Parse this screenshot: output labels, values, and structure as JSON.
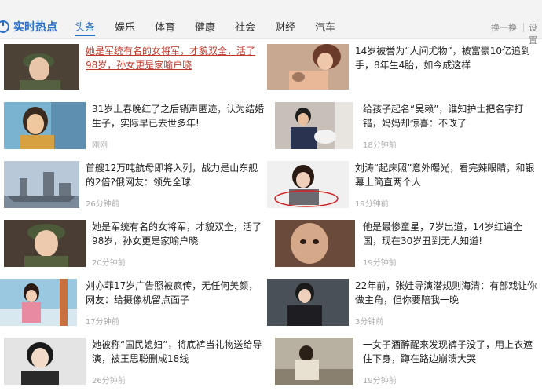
{
  "header": {
    "brand_title": "实时热点",
    "tabs": [
      "头条",
      "娱乐",
      "体育",
      "健康",
      "社会",
      "财经",
      "汽车"
    ],
    "refresh_label": "换一换",
    "settings_label": "设置"
  },
  "left_column": [
    {
      "title": "她是军统有名的女将军，才貌双全，活了98岁，孙女更是家喻户晓",
      "time": "",
      "visited": true
    },
    {
      "title": "31岁上春晚红了之后销声匿迹，认为结婚生子，实际早已去世多年!",
      "time": "刚刚"
    },
    {
      "title": "首艘12万吨航母即将入列，战力是山东舰的2倍?俄网友：领先全球",
      "time": "26分钟前"
    },
    {
      "title": "她是军统有名的女将军，才貌双全，活了98岁，孙女更是家喻户晓",
      "time": "20分钟前"
    },
    {
      "title": "刘亦菲17岁广告照被疯传，无任何美颜，网友：给摄像机留点面子",
      "time": "17分钟前"
    },
    {
      "title": "她被称“国民媳妇”，将底裤当礼物送给导演，被王思聪删成18线",
      "time": "26分钟前"
    }
  ],
  "right_column": [
    {
      "title": "14岁被誉为“人间尤物”，被富豪10亿追到手，8年生4胎，如今成这样",
      "time": ""
    },
    {
      "title": "给孩子起名“吴赖”，谁知护士把名字打错，妈妈却惊喜：不改了",
      "time": "18分钟前"
    },
    {
      "title": "刘涛“起床照”意外曝光，看完辣眼睛，和银幕上简直两个人",
      "time": "19分钟前"
    },
    {
      "title": "他是最惨童星，7岁出道，14岁红遍全国，现在30岁丑到无人知道!",
      "time": "19分钟前"
    },
    {
      "title": "22年前，张娃导演潜规则海清：有部戏让你做主角，但你要陪我一晚",
      "time": "3分钟前"
    },
    {
      "title": "一女子酒醉醒来发现裤子没了，用上衣遮住下身，蹲在路边崩溃大哭",
      "time": "19分钟前"
    }
  ],
  "colors": {
    "accent": "#2a6fc9",
    "visited_link": "#c0392b",
    "timestamp": "#aaaaaa"
  }
}
